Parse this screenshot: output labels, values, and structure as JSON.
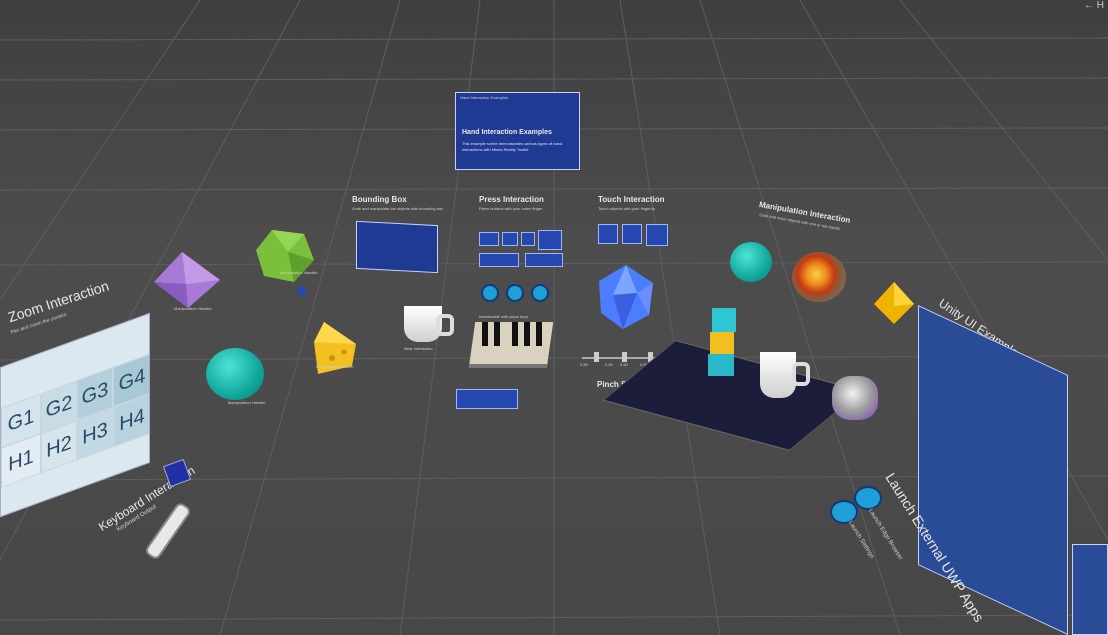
{
  "corner": "← H",
  "main_panel": {
    "header": "Hand Interaction Examples",
    "title": "Hand Interaction Examples",
    "body": "This example scene demonstrates various types of hand interactions with Mixed Reality Toolkit."
  },
  "bounding_box": {
    "title": "Bounding Box",
    "desc": "Grab and manipulate the objects with bounding box"
  },
  "press_interaction": {
    "title": "Press Interaction",
    "desc": "Press buttons with your index finger",
    "piano_label": "Interactable with piano keys"
  },
  "touch_interaction": {
    "title": "Touch Interaction",
    "desc": "Touch objects with your fingertip"
  },
  "manipulation": {
    "title": "Manipulation Interaction",
    "desc": "Grab and move objects with one or two hands"
  },
  "unity_ui": {
    "title": "Unity UI Examples"
  },
  "zoom": {
    "title": "Zoom Interaction",
    "desc": "Pan and zoom the content",
    "tiles": [
      "G1",
      "G2",
      "G3",
      "G4",
      "H1",
      "H2",
      "H3",
      "H4"
    ]
  },
  "keyboard": {
    "title": "Keyboard Interaction",
    "sub": "Keyboard Output"
  },
  "pinch_slider": {
    "title": "Pinch Slider",
    "values": [
      "0.50",
      "0.50",
      "0.50",
      "0.50"
    ]
  },
  "launch": {
    "title": "Launch External UWP Apps",
    "btn1": "Launch Settings",
    "btn2": "Launch Edge Browser"
  },
  "object_labels": {
    "purple": "Manipulation Handler",
    "green": "Manipulation Handler",
    "teal": "Manipulation Handler",
    "cheese": "Manipulation Handler",
    "cup": "Near Interaction",
    "slider": "Pinch Slider"
  }
}
